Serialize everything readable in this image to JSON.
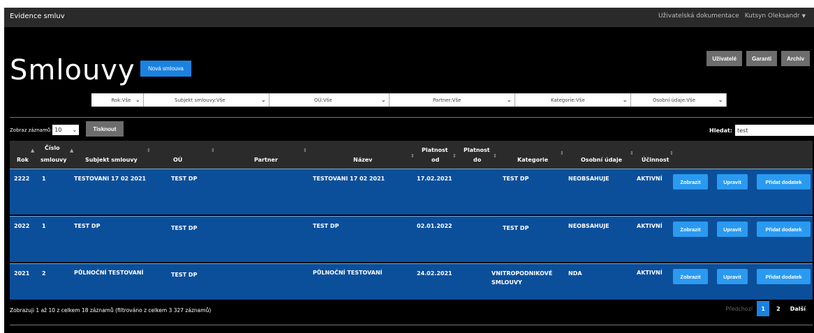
{
  "navbar": {
    "brand": "Evidence smluv",
    "docs_link": "Uživatelská dokumentace",
    "user_name": "Kutsyn Oleksandr"
  },
  "page": {
    "title": "Smlouvy",
    "new_button": "Nová smlouva",
    "users_button": "Uživatelé",
    "guarantors_button": "Garanti",
    "archive_button": "Archiv"
  },
  "filters": [
    {
      "label": "Rok:Vše"
    },
    {
      "label": "Subjekt smlouvy:Vše"
    },
    {
      "label": "OÚ:Vše"
    },
    {
      "label": "Partner:Vše"
    },
    {
      "label": "Kategorie:Vše"
    },
    {
      "label": "Osobní údaje:Vše"
    }
  ],
  "controls": {
    "show_label": "Zobraz záznamů",
    "page_length": "10",
    "print_button": "Tisknout",
    "search_label": "Hledat:",
    "search_value": "test"
  },
  "table": {
    "headers": {
      "rok": "Rok",
      "cislo_1": "Číslo",
      "cislo_2": "smlouvy",
      "subjekt": "Subjekt smlouvy",
      "ou": "OÚ",
      "partner": "Partner",
      "nazev": "Název",
      "pod_1": "Platnost",
      "pod_2": "od",
      "pdo_1": "Platnost",
      "pdo_2": "do",
      "kategorie": "Kategorie",
      "osobni": "Osobní údaje",
      "ucinnost": "Účinnost"
    },
    "rows": [
      {
        "rok": "2222",
        "cislo": "1",
        "subjekt": "TESTOVANI 17 02 2021",
        "ou": "TEST DP",
        "partner": "",
        "nazev": "TESTOVANI 17 02 2021",
        "od": "17.02.2021",
        "do": "",
        "kategorie_1": "TEST DP",
        "kategorie_2": "",
        "osobni": "NEOBSAHUJE",
        "ucinnost": "AKTIVNÍ"
      },
      {
        "rok": "2022",
        "cislo": "1",
        "subjekt": "TEST DP",
        "ou": "TEST DP",
        "partner": "",
        "nazev": "TEST DP",
        "od": "02.01.2022",
        "do": "",
        "kategorie_1": "TEST DP",
        "kategorie_2": "",
        "osobni": "NEOBSAHUJE",
        "ucinnost": "AKTIVNÍ"
      },
      {
        "rok": "2021",
        "cislo": "2",
        "subjekt": "PŮLNOČNÍ TESTOVANÍ",
        "ou": "TEST DP",
        "partner": "",
        "nazev": "PŮLNOČNÍ TESTOVANÍ",
        "od": "24.02.2021",
        "do": "",
        "kategorie_1": "VNITROPODNIKOVÉ",
        "kategorie_2": "SMLOUVY",
        "osobni": "NDA",
        "ucinnost": "AKTIVNÍ"
      }
    ],
    "row_buttons": {
      "show": "Zobrazit",
      "edit": "Upravit",
      "add": "Přidat dodatek"
    }
  },
  "footer": {
    "info": "Zobrazuji 1 až 10 z celkem 18 záznamů (filtrováno z celkem 3 327 záznamů)",
    "prev": "Předchozí",
    "page1": "1",
    "page2": "2",
    "next": "Další"
  }
}
